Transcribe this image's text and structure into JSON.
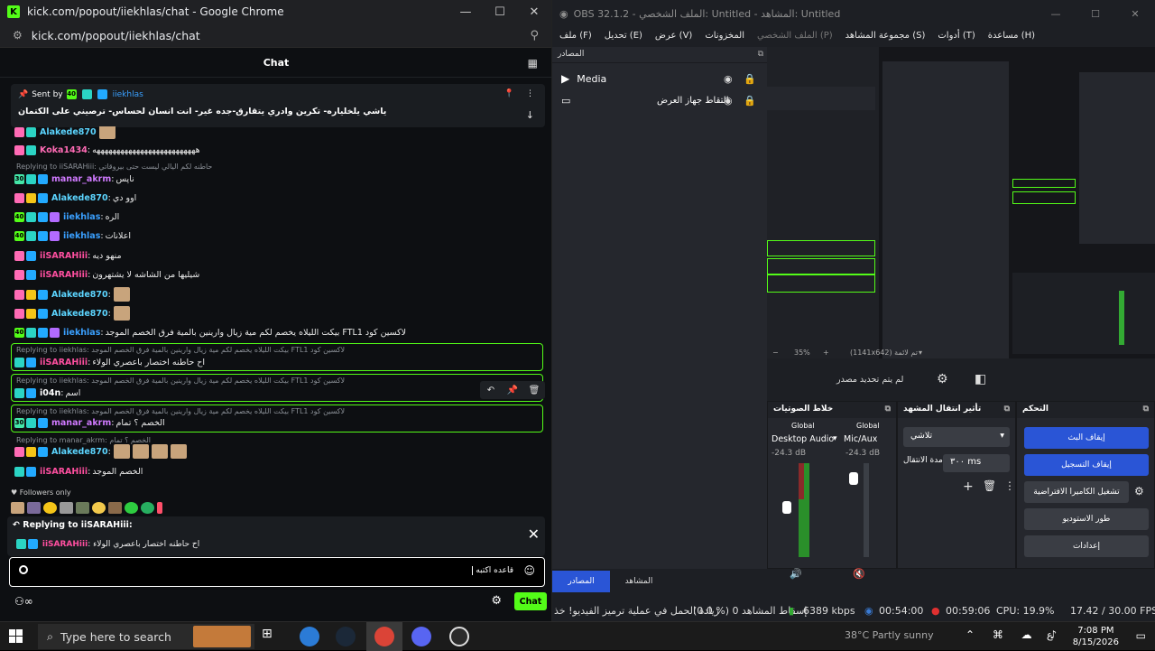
{
  "chrome": {
    "window_title": "kick.com/popout/iiekhlas/chat - Google Chrome",
    "url": "kick.com/popout/iiekhlas/chat",
    "favicon_letter": "K"
  },
  "chat": {
    "header": "Chat",
    "pinned": {
      "sent_by_label": "Sent by",
      "author": "iiekhlas",
      "text": "ياشي يلخلياره- تكرين وادري يتقارق-جده غير- انت انسان لحساس- ترصيني على الكتمان"
    },
    "messages": [
      {
        "user": "Alakede870",
        "color": "#5cd5ff",
        "text": "",
        "emotes": 1
      },
      {
        "user": "Koka1434",
        "color": "#ff6bb5",
        "text": "ههههههههههههههههههههههههههه",
        "emotes": 0
      },
      {
        "reply": "Replying to iiSARAHiii: حاطنه لكم اليالي ليست حتى بيروقاتي"
      },
      {
        "user": "manar_akrm",
        "color": "#d07aff",
        "text": "ناپس",
        "emotes": 0
      },
      {
        "user": "Alakede870",
        "color": "#5cd5ff",
        "text": "اوو دي",
        "emotes": 0
      },
      {
        "user": "iiekhlas",
        "color": "#3aa0ff",
        "text": "الره",
        "emotes": 0
      },
      {
        "user": "iiekhlas",
        "color": "#3aa0ff",
        "text": "اعلانات",
        "emotes": 0
      },
      {
        "user": "iiSARAHiii",
        "color": "#ff4fa0",
        "text": "منهو ديه",
        "emotes": 0
      },
      {
        "user": "iiSARAHiii",
        "color": "#ff4fa0",
        "text": "شيليها من الشاشه لا يشتهرون",
        "emotes": 0
      },
      {
        "user": "Alakede870",
        "color": "#5cd5ff",
        "text": "",
        "emotes": 1
      },
      {
        "user": "Alakede870",
        "color": "#5cd5ff",
        "text": "",
        "emotes": 1
      },
      {
        "user": "iiekhlas",
        "color": "#3aa0ff",
        "text": "بيكت الليلاه يخصم لكم مية زيال وارينين بالمية فرق الخصم الموجد FTL1 لاكسين كود",
        "emotes": 0
      },
      {
        "reply": "Replying to iiekhlas: بيكت الليلاه يخصم لكم مية زيال وارينين بالمية فرق الخصم الموجد FTL1 لاكسين كود"
      },
      {
        "user": "iiSARAHiii",
        "color": "#ff4fa0",
        "text": "اح حاطنه اختصار باعصري الولاء",
        "emotes": 0
      },
      {
        "reply": "Replying to iiekhlas: بيكت الليلاه يخصم لكم مية زيال وارينين بالمية فرق الخصم الموجد FTL1 لاكسين كود"
      },
      {
        "user": "i04n",
        "color": "#ffffff",
        "text": "اسم",
        "emotes": 0
      },
      {
        "reply": "Replying to iiekhlas: بيكت الليلاه يخصم لكم مية زيال وارينين بالمية فرق الخصم الموجد FTL1 لاكسين كود"
      },
      {
        "user": "manar_akrm",
        "color": "#d07aff",
        "text": "الخصم ؟ تمام",
        "emotes": 0
      },
      {
        "reply": "Replying to manar_akrm: الخصم ؟ تمام"
      },
      {
        "user": "Alakede870",
        "color": "#5cd5ff",
        "text": "",
        "emotes": 4
      },
      {
        "user": "iiSARAHiii",
        "color": "#ff4fa0",
        "text": "الخصم الموجد",
        "emotes": 0
      }
    ],
    "followers_only": "Followers only",
    "reply_box": {
      "label": "Replying to iiSARAHiii:",
      "quote_user": "iiSARAHiii",
      "quote_text": "اح حاطنه اختصار باعصري الولاء"
    },
    "input_value": "قاعده اكتبه",
    "send_label": "Chat"
  },
  "obs": {
    "window_title": "OBS 32.1.2 - الملف الشخصي: Untitled - المشاهد: Untitled",
    "menu": [
      "ملف (F)",
      "تحديل (E)",
      "عرض (V)",
      "المخزونات",
      "الملف الشخصي (P)",
      "مجموعة المشاهد (S)",
      "أدوات (T)",
      "مساعدة (H)"
    ],
    "sources_header": "المصادر",
    "sources": [
      {
        "name": "Media"
      },
      {
        "name": "التقاط جهاز العرض"
      }
    ],
    "preview": {
      "zoom": "35%",
      "resolution": "(1141x642) تم لائمة"
    },
    "no_source": "لم يتم تحديد مصدر",
    "mixer": {
      "title": "خلاط الصوتيات",
      "channels": [
        {
          "name": "Desktop Audio",
          "scope": "Global",
          "db": "-24.3 dB"
        },
        {
          "name": "Mic/Aux",
          "scope": "Global",
          "db": "-24.3 dB"
        }
      ],
      "scale": [
        "0",
        "-6",
        "-12",
        "-18",
        "-24",
        "-30",
        "-36",
        "-42",
        "-48",
        "-54",
        "-60"
      ]
    },
    "transitions": {
      "title": "تأثير انتقال المشهد",
      "type": "تلاشي",
      "duration_label": "مدة الانتقال",
      "duration": "٣٠٠ ms"
    },
    "controls": {
      "title": "التحكم",
      "buttons": [
        "إيقاف البث",
        "إيقاف التسجيل",
        "تشغيل الكاميرا الافتراضية",
        "طور الاستوديو",
        "إعدادات"
      ]
    },
    "tabs": [
      "المصادر",
      "المشاهد"
    ],
    "status": {
      "dropped": "زيادة الحمل في عملية ترميز الفيديو! خذ",
      "frames": "(0.0 %) 0 إسقاط المشاهد",
      "bitrate": "6389 kbps",
      "stream_time": "00:54:00",
      "rec_time": "00:59:06",
      "cpu": "CPU: 19.9%",
      "fps": "17.42 / 30.00 FPS"
    }
  },
  "taskbar": {
    "search_placeholder": "Type here to search",
    "weather": "38°C  Partly sunny",
    "time": "7:08 PM",
    "date": "8/15/2026",
    "lang": "ع"
  }
}
